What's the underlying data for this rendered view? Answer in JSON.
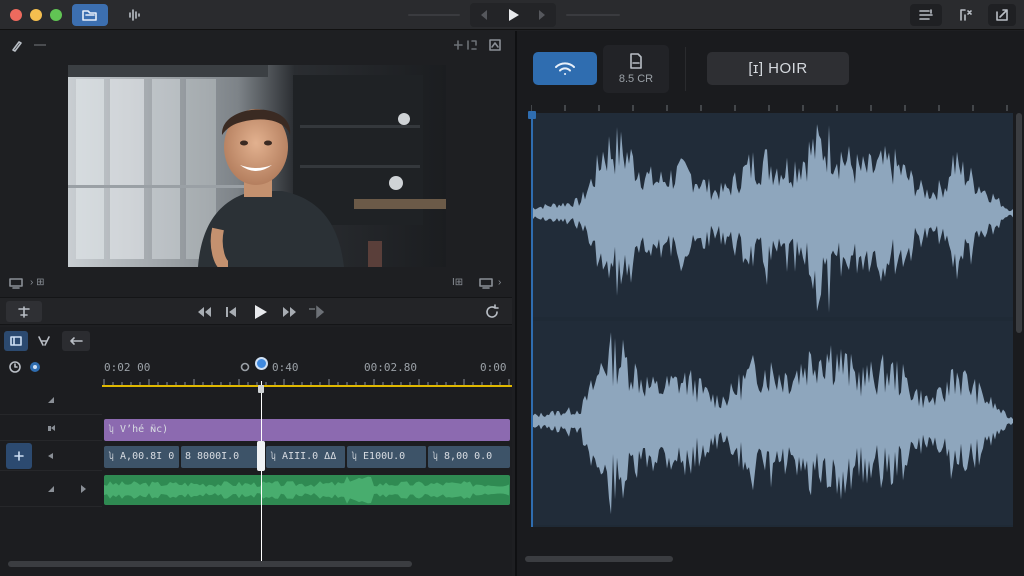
{
  "titlebar": {
    "traffic_lights": [
      "#ed6a5e",
      "#f5bf4f",
      "#61c554"
    ],
    "active_tool_color": "#3c6fb0"
  },
  "viewer": {
    "footer_left": "› ⊞",
    "footer_right": "I⊞"
  },
  "timeline": {
    "timecodes": [
      "0:02 00",
      "0:40",
      "00:02.80",
      "0:00"
    ],
    "tracks": {
      "title_clip": "ʮ Vʼhé ɴ̈c)",
      "video_clips": [
        "ʮ A,00.8I 0",
        "8 8000I.0",
        "ʮ AIII.0 ΔΔ",
        "ʮ Ε100U.0",
        "ʮ 8,00 0.0"
      ],
      "playhead_color": "#ffffff",
      "ruler_color": "#e0b800"
    }
  },
  "inspector": {
    "file_label": "8.5 CR",
    "mode_label": "[ɪ] HOIR",
    "accent": "#2f6db0"
  }
}
